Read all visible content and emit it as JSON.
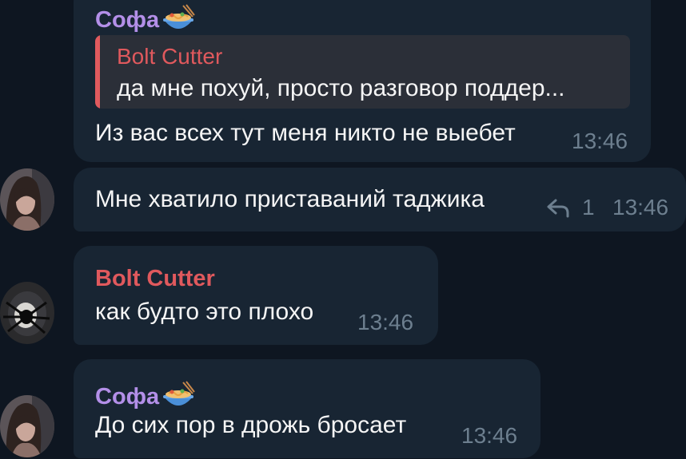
{
  "colors": {
    "background": "#0e1621",
    "bubble": "#182533",
    "sender_sofa": "#b38fe8",
    "sender_bolt": "#e0595d",
    "quote_bar": "#e05a5e",
    "quote_bg": "#2b2f38",
    "time": "#6d7f8f",
    "text": "#f5f5f5"
  },
  "messages": [
    {
      "sender": "Софа",
      "sender_emoji": "noodle-bowl-icon",
      "reply": {
        "name": "Bolt Cutter",
        "text": "да мне похуй, просто разговор поддер..."
      },
      "text": "Из вас всех тут меня никто не выебет",
      "time": "13:46"
    },
    {
      "avatar": "girl-avatar",
      "text": "Мне хватило приставаний таджика",
      "reply_count": "1",
      "time": "13:46"
    },
    {
      "sender": "Bolt Cutter",
      "avatar": "spider-avatar",
      "text": "как будто это плохо",
      "time": "13:46"
    },
    {
      "sender": "Софа",
      "sender_emoji": "noodle-bowl-icon",
      "avatar": "girl-avatar",
      "text": "До сих пор в дрожь бросает",
      "time": "13:46"
    }
  ]
}
